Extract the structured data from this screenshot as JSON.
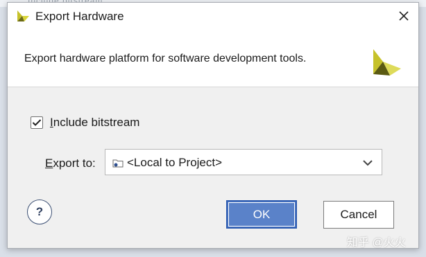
{
  "background": {
    "partial_text": "Include bitstream"
  },
  "dialog": {
    "title": "Export Hardware",
    "description": "Export hardware platform for software development tools.",
    "include_bitstream": {
      "label": "Include bitstream",
      "checked": true
    },
    "export_to": {
      "label": "Export to:",
      "selected_value": "<Local to Project>"
    },
    "buttons": {
      "help": "?",
      "ok": "OK",
      "cancel": "Cancel"
    }
  },
  "watermark": "知乎 @火火",
  "colors": {
    "ok_button": "#5a82c9",
    "ok_border": "#2d5bb0",
    "logo_yellow": "#c6c22a",
    "logo_dark": "#6b6a18",
    "dialog_bg": "#f0f0f0"
  },
  "icons": {
    "title_logo": "vivado-logo-icon",
    "close": "close-icon",
    "big_logo": "vivado-logo-icon",
    "checkbox": "checkmark-icon",
    "combo_folder": "folder-icon",
    "combo_arrow": "chevron-down-icon"
  }
}
